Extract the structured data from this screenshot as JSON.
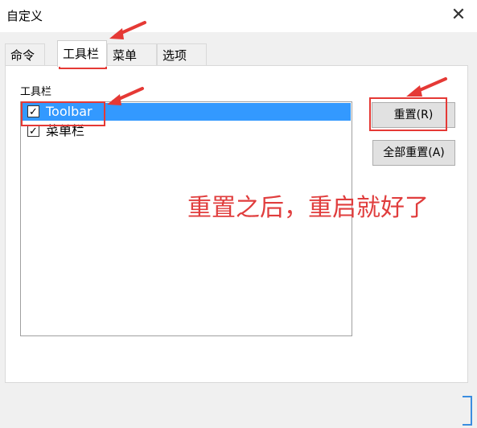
{
  "window": {
    "title": "自定义",
    "close_glyph": "✕"
  },
  "tabs": [
    {
      "label": "命令",
      "active": false
    },
    {
      "label": "工具栏",
      "active": true
    },
    {
      "label": "菜单",
      "active": false
    },
    {
      "label": "选项",
      "active": false
    }
  ],
  "toolbar_panel": {
    "group_label": "工具栏",
    "items": [
      {
        "label": "Toolbar",
        "checked": true,
        "selected": true
      },
      {
        "label": "菜单栏",
        "checked": true,
        "selected": false
      }
    ],
    "reset_button": "重置(R)",
    "reset_all_button": "全部重置(A)"
  },
  "annotation": {
    "text": "重置之后，重启就好了",
    "color": "#e03d3d"
  },
  "icons": {
    "check": "check-icon",
    "close": "close-icon",
    "arrow": "red-arrow-icon"
  }
}
